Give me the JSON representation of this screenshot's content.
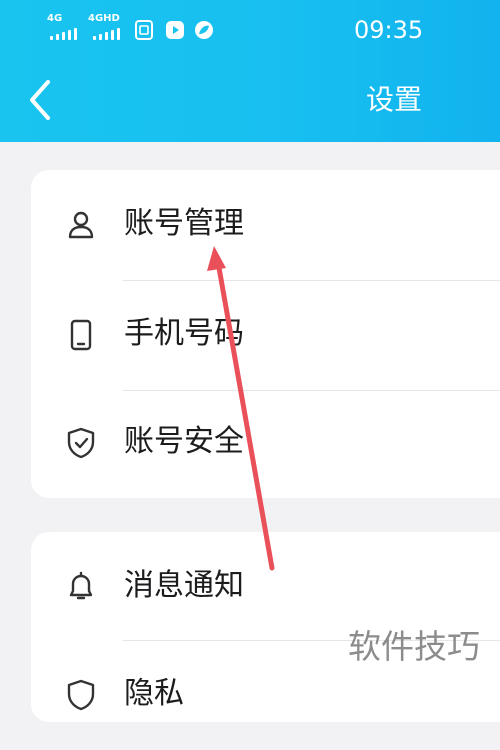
{
  "status_bar": {
    "signal1_label": "4G",
    "signal2_label": "4GHD",
    "time": "09:35",
    "icons": [
      "signal-icon",
      "signal-icon",
      "sim-icon",
      "video-app-icon",
      "leaf-app-icon"
    ]
  },
  "header": {
    "title": "设置",
    "back_icon": "chevron-left-icon",
    "color": "#19c4ef"
  },
  "settings_group1": [
    {
      "label": "账号管理",
      "icon": "user-icon"
    },
    {
      "label": "手机号码",
      "icon": "phone-icon"
    },
    {
      "label": "账号安全",
      "icon": "shield-icon"
    }
  ],
  "settings_group2": [
    {
      "label": "消息通知",
      "icon": "bell-icon"
    },
    {
      "label": "隐私",
      "icon": "shield-icon"
    }
  ],
  "annotation": {
    "color": "#e9505a"
  },
  "watermark": "软件技巧"
}
